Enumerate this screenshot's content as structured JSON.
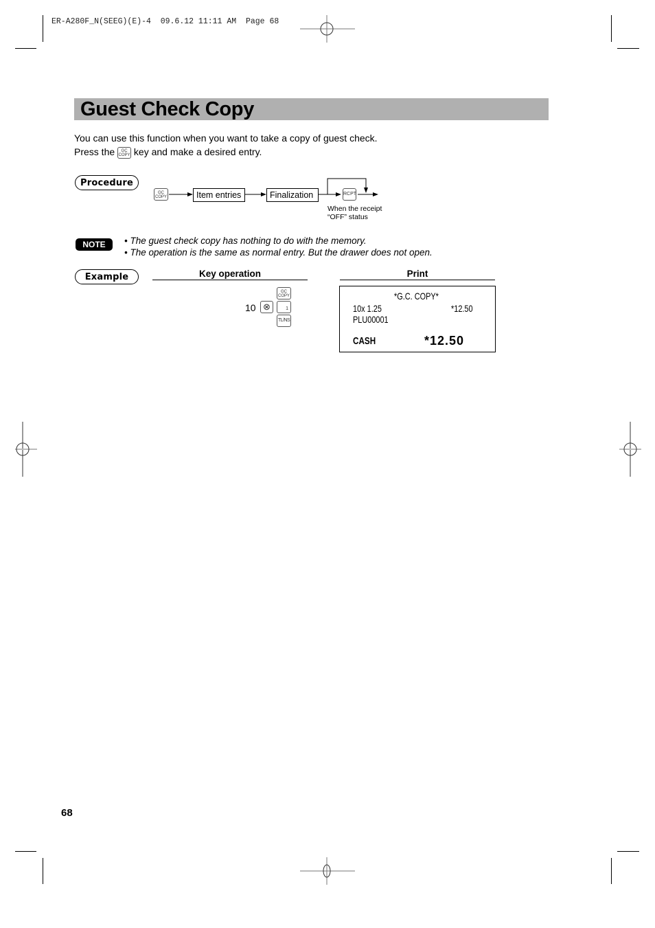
{
  "slug": "ER-A280F_N(SEEG)(E)-4  09.6.12 11:11 AM  Page 68",
  "title": "Guest Check Copy",
  "intro": {
    "line1": "You can use this function when you want to take a copy of guest check.",
    "line2_before": "Press the",
    "line2_key": {
      "top": "GC",
      "bottom": "COPY"
    },
    "line2_after": "key and make a desired entry."
  },
  "procedure": {
    "label": "Procedure",
    "start_key": {
      "top": "GC",
      "bottom": "COPY"
    },
    "steps": [
      "Item entries",
      "Finalization"
    ],
    "end_key": "RCPT",
    "end_note_line1": "When the receipt",
    "end_note_line2": "“OFF” status"
  },
  "note": {
    "badge": "NOTE",
    "items": [
      "• The guest check copy has nothing to do with the memory.",
      "• The operation is the same as normal entry.  But the drawer does not open."
    ]
  },
  "example": {
    "label": "Example",
    "key_operation_heading": "Key operation",
    "print_heading": "Print",
    "keys": {
      "quantity": "10",
      "multiply_key": "⊗",
      "gc_copy_key": {
        "top": "GC",
        "bottom": "COPY"
      },
      "plu_key": "1",
      "total_key": "TL/NS"
    },
    "receipt": {
      "header": "*G.C. COPY*",
      "line1_left": "10x 1.25",
      "line1_right": "*12.50",
      "line2": "PLU00001",
      "total_label": "CASH",
      "total_value": "*12.50"
    }
  },
  "page_number": "68"
}
